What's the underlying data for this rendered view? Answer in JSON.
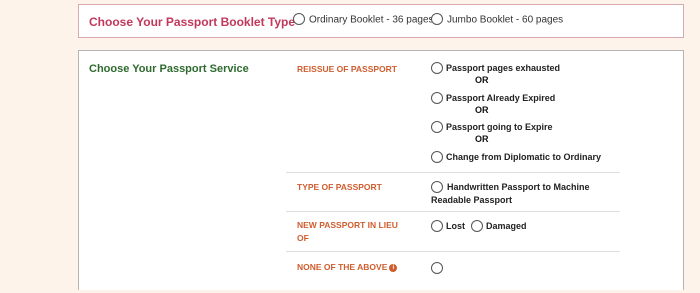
{
  "booklet": {
    "title": "Choose Your Passport Booklet Type",
    "options": [
      {
        "label": "Ordinary Booklet - 36 pages"
      },
      {
        "label": "Jumbo Booklet - 60 pages"
      }
    ]
  },
  "service": {
    "title": "Choose Your Passport Service",
    "categories": [
      {
        "label": "REISSUE OF PASSPORT"
      },
      {
        "label": "TYPE OF PASSPORT"
      },
      {
        "label": "NEW PASSPORT IN LIEU OF"
      },
      {
        "label": "NONE OF THE ABOVE"
      }
    ],
    "reissue_options": [
      {
        "label": "Passport pages exhausted"
      },
      {
        "label": "Passport Already Expired"
      },
      {
        "label": "Passport going to Expire"
      },
      {
        "label": "Change from Diplomatic to Ordinary"
      }
    ],
    "or_label": "OR",
    "type_option": {
      "label": "Handwritten Passport to Machine Readable Passport"
    },
    "lieu_options": [
      {
        "label": "Lost"
      },
      {
        "label": "Damaged"
      }
    ],
    "info_icon_glyph": "i"
  }
}
